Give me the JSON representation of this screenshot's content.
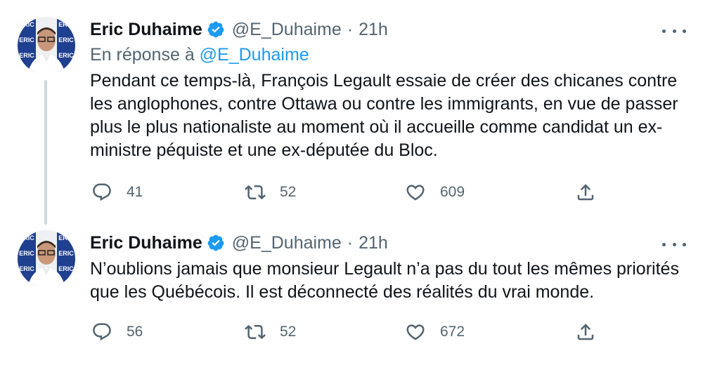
{
  "tweets": [
    {
      "author": {
        "display_name": "Eric Duhaime",
        "handle": "@E_Duhaime",
        "verified": true,
        "avatar_banner_text": "ERIC"
      },
      "time": "21h",
      "separator": "·",
      "reply_to": {
        "prefix": "En réponse à",
        "mention": "@E_Duhaime"
      },
      "text": "Pendant ce temps-là, François Legault essaie de créer des chicanes contre les anglophones, contre Ottawa ou contre les immigrants, en vue de passer plus le plus nationaliste au moment où il accueille comme candidat un ex-ministre péquiste et une ex-députée du Bloc.",
      "stats": {
        "replies": "41",
        "retweets": "52",
        "likes": "609"
      }
    },
    {
      "author": {
        "display_name": "Eric Duhaime",
        "handle": "@E_Duhaime",
        "verified": true,
        "avatar_banner_text": "ERIC"
      },
      "time": "21h",
      "separator": "·",
      "text": "N’oublions jamais que monsieur Legault n’a pas du tout les mêmes priorités que les Québécois. Il est déconnecté des réalités du vrai monde.",
      "stats": {
        "replies": "56",
        "retweets": "52",
        "likes": "672"
      }
    }
  ],
  "icons": {
    "reply": "reply-icon",
    "retweet": "retweet-icon",
    "like": "heart-icon",
    "share": "share-icon",
    "more": "more-options-icon",
    "verified": "verified-badge-icon"
  },
  "colors": {
    "text_primary": "#0f1419",
    "text_secondary": "#536471",
    "accent": "#1d9bf0",
    "thread_line": "#cfd9de",
    "avatar_banner": "#1f3f8f"
  }
}
